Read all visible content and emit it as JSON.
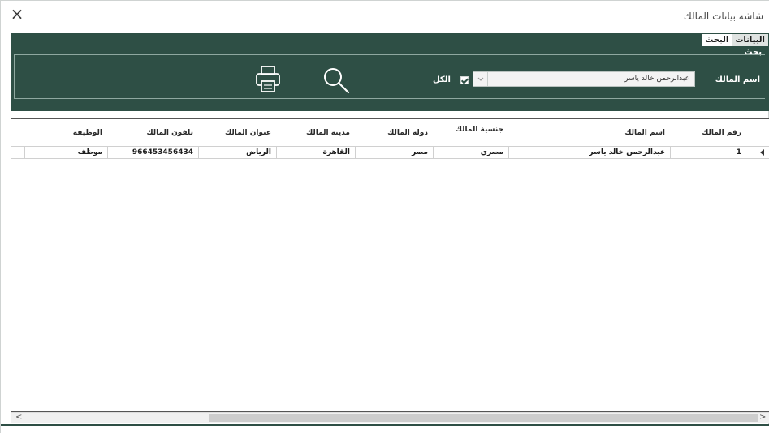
{
  "window": {
    "title": "شاشة بيانات المالك",
    "close_glyph": "×"
  },
  "tabs": [
    {
      "label": "البيانات",
      "active": false
    },
    {
      "label": "البحث",
      "active": true
    }
  ],
  "search_panel": {
    "group_label": "بحث",
    "owner_label": "اسم المالك",
    "owner_value": "عبدالرحمن خالد ياسر",
    "all_label": "الكل",
    "all_checked": true
  },
  "grid": {
    "columns": [
      "رقم المالك",
      "اسم المالك",
      "جنسية المالك",
      "دولة المالك",
      "مدينة المالك",
      "عنوان المالك",
      "تلفون المالك",
      "الوظيفة"
    ],
    "rows": [
      [
        "1",
        "عبدالرحمن خالد ياسر",
        "مصري",
        "مصر",
        "القاهرة",
        "الرياض",
        "966453456434",
        "موظف"
      ]
    ]
  },
  "scrollbar": {
    "left_arrow": "<",
    "right_arrow": ">"
  },
  "colors": {
    "panel": "#2e4f45",
    "panel_text": "#ffffff"
  },
  "icons": [
    "close-icon",
    "search-icon",
    "print-icon",
    "checkbox-icon",
    "row-pointer-icon"
  ]
}
